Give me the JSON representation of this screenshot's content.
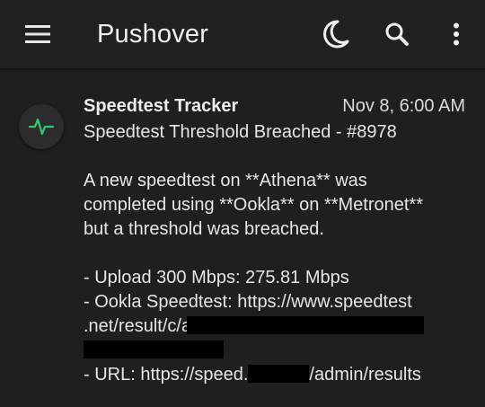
{
  "app_bar": {
    "title": "Pushover",
    "icons": {
      "menu": "menu-icon",
      "theme": "moon-icon",
      "search": "search-icon",
      "more": "more-vert-icon"
    }
  },
  "message": {
    "avatar_icon": "activity-pulse-icon",
    "avatar_color": "#2ecc71",
    "sender": "Speedtest Tracker",
    "timestamp": "Nov 8, 6:00 AM",
    "title": "Speedtest Threshold Breached - #8978",
    "body": {
      "line1": "A new speedtest on **Athena** was",
      "line2": "completed using **Ookla** on **Metronet**",
      "line3": "but a threshold was breached.",
      "line4": "- Upload 300 Mbps: 275.81 Mbps",
      "line5": "- Ookla Speedtest: https://www.speedtest",
      "line6": ".net/result/c/",
      "line6_tail": "a",
      "line8_prefix": "- URL: https://speed.",
      "line8_suffix": "/admin/results"
    }
  },
  "colors": {
    "background": "#1f1f1f",
    "app_bar": "#212121",
    "text": "#e6e6e6",
    "redaction": "#000000"
  }
}
